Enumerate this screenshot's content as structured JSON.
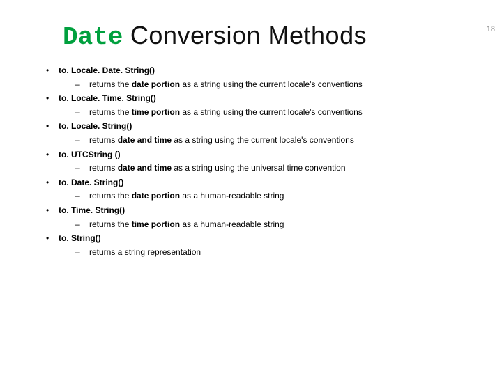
{
  "slide_number": "18",
  "title": {
    "highlight": "Date",
    "rest": " Conversion Methods"
  },
  "items": [
    {
      "method": "to. Locale. Date. String()",
      "desc_pre": "returns the ",
      "desc_bold": "date portion",
      "desc_post": " as a string using the current locale's conventions"
    },
    {
      "method": "to. Locale. Time. String()",
      "desc_pre": "returns the ",
      "desc_bold": "time portion",
      "desc_post": " as a string using the current locale's conventions"
    },
    {
      "method": "to. Locale. String()",
      "desc_pre": "returns ",
      "desc_bold": "date and time",
      "desc_post": " as a string using the current locale's conventions"
    },
    {
      "method": "to. UTCString ()",
      "desc_pre": "returns ",
      "desc_bold": "date and time",
      "desc_post": " as a string using the universal time convention"
    },
    {
      "method": "to. Date. String()",
      "desc_pre": "returns the ",
      "desc_bold": "date portion",
      "desc_post": " as a human-readable string"
    },
    {
      "method": "to. Time. String()",
      "desc_pre": "returns the ",
      "desc_bold": "time portion",
      "desc_post": " as a human-readable string"
    },
    {
      "method": "to. String()",
      "desc_pre": "returns a string representation",
      "desc_bold": "",
      "desc_post": ""
    }
  ]
}
